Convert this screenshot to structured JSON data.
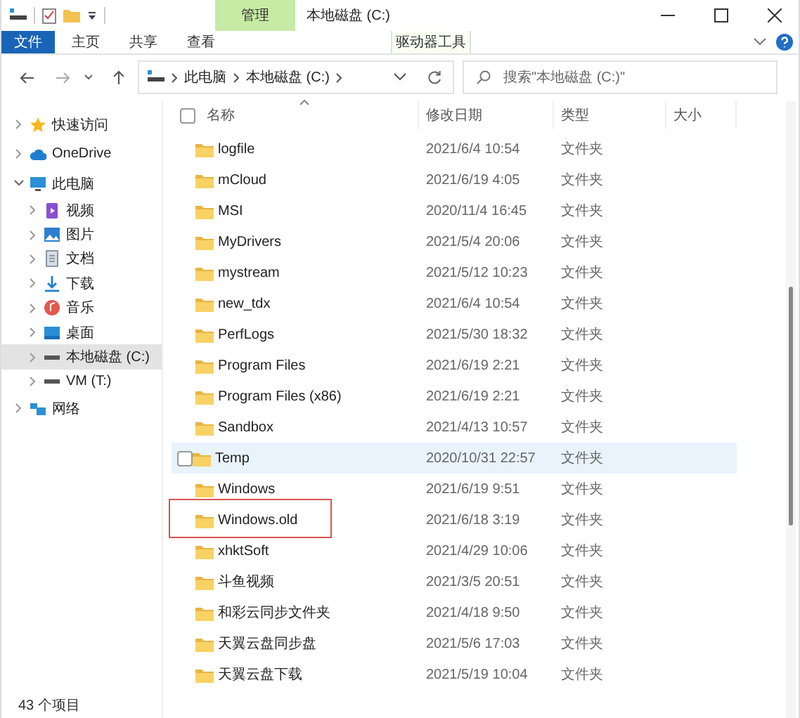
{
  "window": {
    "title": "本地磁盘 (C:)"
  },
  "ribbon": {
    "tabs": [
      {
        "label": "文件",
        "kind": "file",
        "selected": false
      },
      {
        "label": "主页",
        "kind": "plain",
        "selected": false
      },
      {
        "label": "共享",
        "kind": "plain",
        "selected": false
      },
      {
        "label": "查看",
        "kind": "plain",
        "selected": false
      },
      {
        "label": "驱动器工具",
        "kind": "context",
        "context_label": "管理",
        "selected": false
      }
    ]
  },
  "address_bar": {
    "path": [
      "此电脑",
      "本地磁盘 (C:)"
    ]
  },
  "search": {
    "placeholder": "搜索\"本地磁盘 (C:)\""
  },
  "sidebar": {
    "items": [
      {
        "label": "快速访问",
        "kind": "star",
        "expanded": false,
        "selected": false
      },
      {
        "label": "OneDrive",
        "kind": "cloud",
        "expanded": false,
        "selected": false
      },
      {
        "label": "此电脑",
        "kind": "pc",
        "expanded": true,
        "selected": false,
        "children": [
          {
            "label": "视频",
            "kind": "video",
            "expanded": false,
            "selected": false
          },
          {
            "label": "图片",
            "kind": "picture",
            "expanded": false,
            "selected": false
          },
          {
            "label": "文档",
            "kind": "document",
            "expanded": false,
            "selected": false
          },
          {
            "label": "下载",
            "kind": "download",
            "expanded": false,
            "selected": false
          },
          {
            "label": "音乐",
            "kind": "music",
            "expanded": false,
            "selected": false
          },
          {
            "label": "桌面",
            "kind": "desktop",
            "expanded": false,
            "selected": false
          },
          {
            "label": "本地磁盘 (C:)",
            "kind": "drive",
            "expanded": false,
            "selected": true
          },
          {
            "label": "VM (T:)",
            "kind": "drive",
            "expanded": false,
            "selected": false
          }
        ]
      },
      {
        "label": "网络",
        "kind": "network",
        "expanded": false,
        "selected": false
      }
    ]
  },
  "table": {
    "columns": [
      "名称",
      "修改日期",
      "类型",
      "大小"
    ],
    "all_checked": false,
    "rows": [
      {
        "name": "logfile",
        "date": "2021/6/4 10:54",
        "type": "文件夹",
        "hovered": false,
        "marked": false,
        "checked": false
      },
      {
        "name": "mCloud",
        "date": "2021/6/19 4:05",
        "type": "文件夹",
        "hovered": false,
        "marked": false,
        "checked": false
      },
      {
        "name": "MSI",
        "date": "2020/11/4 16:45",
        "type": "文件夹",
        "hovered": false,
        "marked": false,
        "checked": false
      },
      {
        "name": "MyDrivers",
        "date": "2021/5/4 20:06",
        "type": "文件夹",
        "hovered": false,
        "marked": false,
        "checked": false
      },
      {
        "name": "mystream",
        "date": "2021/5/12 10:23",
        "type": "文件夹",
        "hovered": false,
        "marked": false,
        "checked": false
      },
      {
        "name": "new_tdx",
        "date": "2021/6/4 10:54",
        "type": "文件夹",
        "hovered": false,
        "marked": false,
        "checked": false
      },
      {
        "name": "PerfLogs",
        "date": "2021/5/30 18:32",
        "type": "文件夹",
        "hovered": false,
        "marked": false,
        "checked": false
      },
      {
        "name": "Program Files",
        "date": "2021/6/19 2:21",
        "type": "文件夹",
        "hovered": false,
        "marked": false,
        "checked": false
      },
      {
        "name": "Program Files (x86)",
        "date": "2021/6/19 2:21",
        "type": "文件夹",
        "hovered": false,
        "marked": false,
        "checked": false
      },
      {
        "name": "Sandbox",
        "date": "2021/4/13 10:57",
        "type": "文件夹",
        "hovered": false,
        "marked": false,
        "checked": false
      },
      {
        "name": "Temp",
        "date": "2020/10/31 22:57",
        "type": "文件夹",
        "hovered": true,
        "marked": false,
        "checked": false
      },
      {
        "name": "Windows",
        "date": "2021/6/19 9:51",
        "type": "文件夹",
        "hovered": false,
        "marked": false,
        "checked": false
      },
      {
        "name": "Windows.old",
        "date": "2021/6/18 3:19",
        "type": "文件夹",
        "hovered": false,
        "marked": true,
        "checked": false
      },
      {
        "name": "xhktSoft",
        "date": "2021/4/29 10:06",
        "type": "文件夹",
        "hovered": false,
        "marked": false,
        "checked": false
      },
      {
        "name": "斗鱼视频",
        "date": "2021/3/5 20:51",
        "type": "文件夹",
        "hovered": false,
        "marked": false,
        "checked": false
      },
      {
        "name": "和彩云同步文件夹",
        "date": "2021/4/18 9:50",
        "type": "文件夹",
        "hovered": false,
        "marked": false,
        "checked": false
      },
      {
        "name": "天翼云盘同步盘",
        "date": "2021/5/6 17:03",
        "type": "文件夹",
        "hovered": false,
        "marked": false,
        "checked": false
      },
      {
        "name": "天翼云盘下载",
        "date": "2021/5/19 10:04",
        "type": "文件夹",
        "hovered": false,
        "marked": false,
        "checked": false
      }
    ]
  },
  "status_bar": {
    "count": "43 个项目"
  }
}
